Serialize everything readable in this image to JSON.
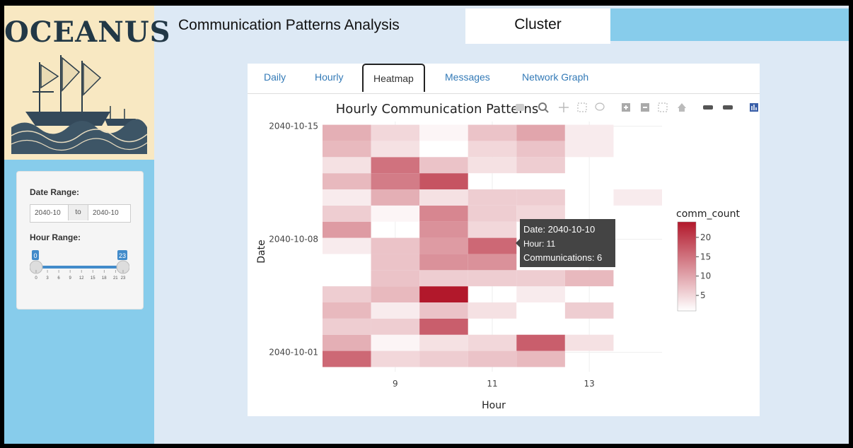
{
  "logo": {
    "text": "OCEANUS"
  },
  "header": {
    "title": "Communication Patterns Analysis",
    "cluster_tab": "Cluster"
  },
  "sidebar": {
    "date_range_label": "Date Range:",
    "date_start": "2040-10",
    "date_sep": "to",
    "date_end": "2040-10",
    "hour_range_label": "Hour Range:",
    "hour_min": "0",
    "hour_max": "23",
    "slider_ticks": [
      "0",
      "3",
      "6",
      "9",
      "12",
      "15",
      "18",
      "21",
      "23"
    ]
  },
  "tabs": [
    "Daily",
    "Hourly",
    "Heatmap",
    "Messages",
    "Network Graph"
  ],
  "active_tab": "Heatmap",
  "tooltip": {
    "line1": "Date: 2040-10-10",
    "line2": "Hour: 11",
    "line3": "Communications: 6"
  },
  "colors": {
    "low": "#ffffff",
    "high": "#b2182b",
    "sidebar": "#87cceb",
    "link": "#337ab7"
  },
  "modebar_icons": [
    "camera-icon",
    "zoom-icon",
    "pan-icon",
    "box-select-icon",
    "lasso-icon",
    "zoom-in-icon",
    "zoom-out-icon",
    "autoscale-icon",
    "home-icon",
    "spike-lines-icon",
    "compare-icon",
    "plotly-logo-icon"
  ],
  "chart_data": {
    "type": "heatmap",
    "title": "Hourly Communication Patterns",
    "xlabel": "Hour",
    "ylabel": "Date",
    "x_range": [
      7.5,
      14.5
    ],
    "x_ticks": [
      "9",
      "11",
      "13"
    ],
    "y_ticks": [
      "2040-10-15",
      "2040-10-08",
      "2040-10-01"
    ],
    "y": [
      "2040-10-01",
      "2040-10-02",
      "2040-10-03",
      "2040-10-04",
      "2040-10-05",
      "2040-10-06",
      "2040-10-07",
      "2040-10-08",
      "2040-10-09",
      "2040-10-10",
      "2040-10-11",
      "2040-10-12",
      "2040-10-13",
      "2040-10-14"
    ],
    "x": [
      8,
      9,
      10,
      11,
      12,
      13,
      14
    ],
    "z": [
      [
        16,
        5,
        6,
        7,
        8,
        null,
        null
      ],
      [
        9,
        2,
        4,
        5,
        17,
        4,
        null
      ],
      [
        6,
        6,
        17,
        null,
        null,
        null,
        null
      ],
      [
        8,
        3,
        7,
        4,
        1,
        6,
        null
      ],
      [
        6,
        8,
        24,
        null,
        3,
        null,
        null
      ],
      [
        null,
        7,
        6,
        6,
        6,
        8,
        null
      ],
      [
        null,
        7,
        12,
        12,
        null,
        null,
        null
      ],
      [
        3,
        7,
        11,
        16,
        null,
        null,
        null
      ],
      [
        11,
        null,
        12,
        5,
        null,
        null,
        null
      ],
      [
        6,
        2,
        13,
        6,
        5,
        null,
        null
      ],
      [
        3,
        9,
        4,
        6,
        6,
        null,
        3
      ],
      [
        8,
        14,
        18,
        null,
        null,
        null,
        null
      ],
      [
        4,
        15,
        7,
        4,
        6,
        null,
        null
      ],
      [
        8,
        4,
        null,
        5,
        7,
        3,
        null
      ],
      [
        9,
        5,
        2,
        7,
        10,
        3,
        null
      ]
    ],
    "colorbar": {
      "title": "comm_count",
      "min": 1,
      "max": 24,
      "ticks": [
        "5",
        "10",
        "15",
        "20"
      ]
    }
  }
}
